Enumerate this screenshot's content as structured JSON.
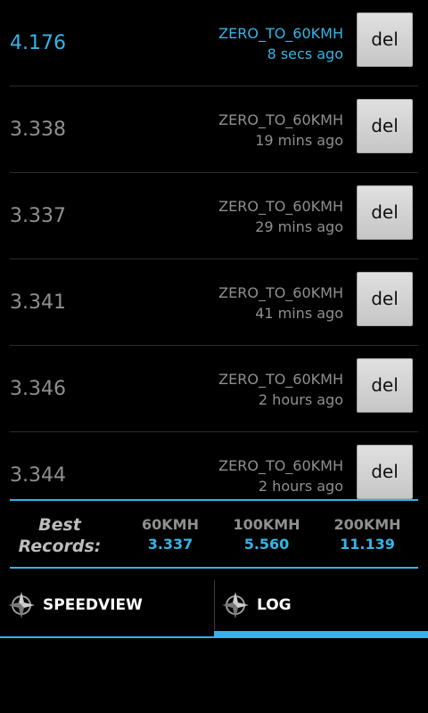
{
  "log": {
    "rows": [
      {
        "value": "4.176",
        "type": "ZERO_TO_60KMH",
        "time": "8 secs ago",
        "del_label": "del"
      },
      {
        "value": "3.338",
        "type": "ZERO_TO_60KMH",
        "time": "19 mins ago",
        "del_label": "del"
      },
      {
        "value": "3.337",
        "type": "ZERO_TO_60KMH",
        "time": "29 mins ago",
        "del_label": "del"
      },
      {
        "value": "3.341",
        "type": "ZERO_TO_60KMH",
        "time": "41 mins ago",
        "del_label": "del"
      },
      {
        "value": "3.346",
        "type": "ZERO_TO_60KMH",
        "time": "2 hours ago",
        "del_label": "del"
      },
      {
        "value": "3.344",
        "type": "ZERO_TO_60KMH",
        "time": "2 hours ago",
        "del_label": "del"
      }
    ]
  },
  "best_records": {
    "label_line1": "Best",
    "label_line2": "Records:",
    "columns": [
      {
        "header": "60KMH",
        "value": "3.337"
      },
      {
        "header": "100KMH",
        "value": "5.560"
      },
      {
        "header": "200KMH",
        "value": "11.139"
      }
    ]
  },
  "tabs": [
    {
      "label": "SPEEDVIEW",
      "icon": "compass-icon",
      "selected": false
    },
    {
      "label": "LOG",
      "icon": "compass-icon",
      "selected": true
    }
  ],
  "colors": {
    "accent": "#33b5e5",
    "background": "#000000",
    "muted_text": "#8f8f8f"
  }
}
